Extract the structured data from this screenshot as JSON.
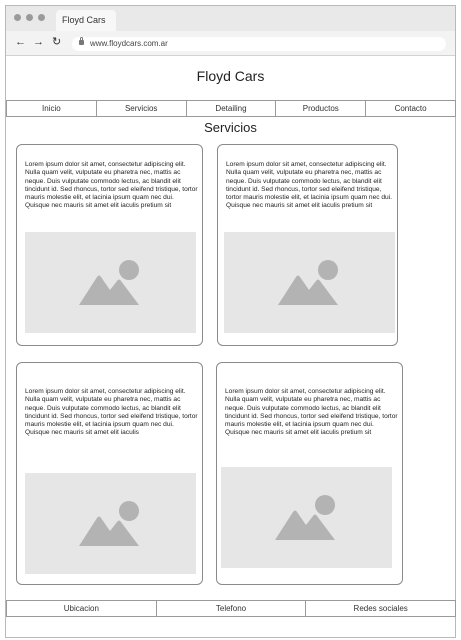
{
  "browser": {
    "tab_title": "Floyd Cars",
    "url": "www.floydcars.com.ar",
    "back_icon": "←",
    "forward_icon": "→",
    "reload_icon": "↻"
  },
  "header": {
    "site_title": "Floyd Cars"
  },
  "menu": [
    {
      "label": "Inicio"
    },
    {
      "label": "Servicios"
    },
    {
      "label": "Detailing"
    },
    {
      "label": "Productos"
    },
    {
      "label": "Contacto"
    }
  ],
  "section": {
    "title": "Servicios"
  },
  "cards": [
    {
      "text": "Lorem ipsum dolor sit amet, consectetur adipiscing elit. Nulla quam velit, vulputate eu pharetra nec, mattis ac neque. Duis vulputate commodo lectus, ac blandit elit tincidunt id. Sed rhoncus, tortor sed eleifend tristique, tortor mauris molestie elit, et lacinia ipsum quam nec dui. Quisque nec mauris sit amet elit iaculis pretium sit",
      "image_icon": "image-placeholder-icon"
    },
    {
      "text": "Lorem ipsum dolor sit amet, consectetur adipiscing elit. Nulla quam velit, vulputate eu pharetra nec, mattis ac neque. Duis vulputate commodo lectus, ac blandit elit tincidunt id. Sed rhoncus, tortor sed eleifend tristique, tortor mauris molestie elit, et lacinia ipsum quam nec dui. Quisque nec mauris sit amet elit iaculis pretium sit",
      "image_icon": "image-placeholder-icon"
    },
    {
      "text": "Lorem ipsum dolor sit amet, consectetur adipiscing elit. Nulla quam velit, vulputate eu pharetra nec, mattis ac neque. Duis vulputate commodo lectus, ac blandit elit tincidunt id. Sed rhoncus, tortor sed eleifend tristique, tortor mauris molestie elit, et lacinia ipsum quam nec dui. Quisque nec mauris sit amet elit iaculis",
      "image_icon": "image-placeholder-icon"
    },
    {
      "text": "Lorem ipsum dolor sit amet, consectetur adipiscing elit. Nulla quam velit, vulputate eu pharetra nec, mattis ac neque. Duis vulputate commodo lectus, ac blandit elit tincidunt id. Sed rhoncus, tortor sed eleifend tristique, tortor mauris molestie elit, et lacinia ipsum quam nec dui. Quisque nec mauris sit amet elit iaculis pretium sit",
      "image_icon": "image-placeholder-icon"
    }
  ],
  "footer": [
    {
      "label": "Ubicacion"
    },
    {
      "label": "Telefono"
    },
    {
      "label": "Redes sociales"
    }
  ]
}
